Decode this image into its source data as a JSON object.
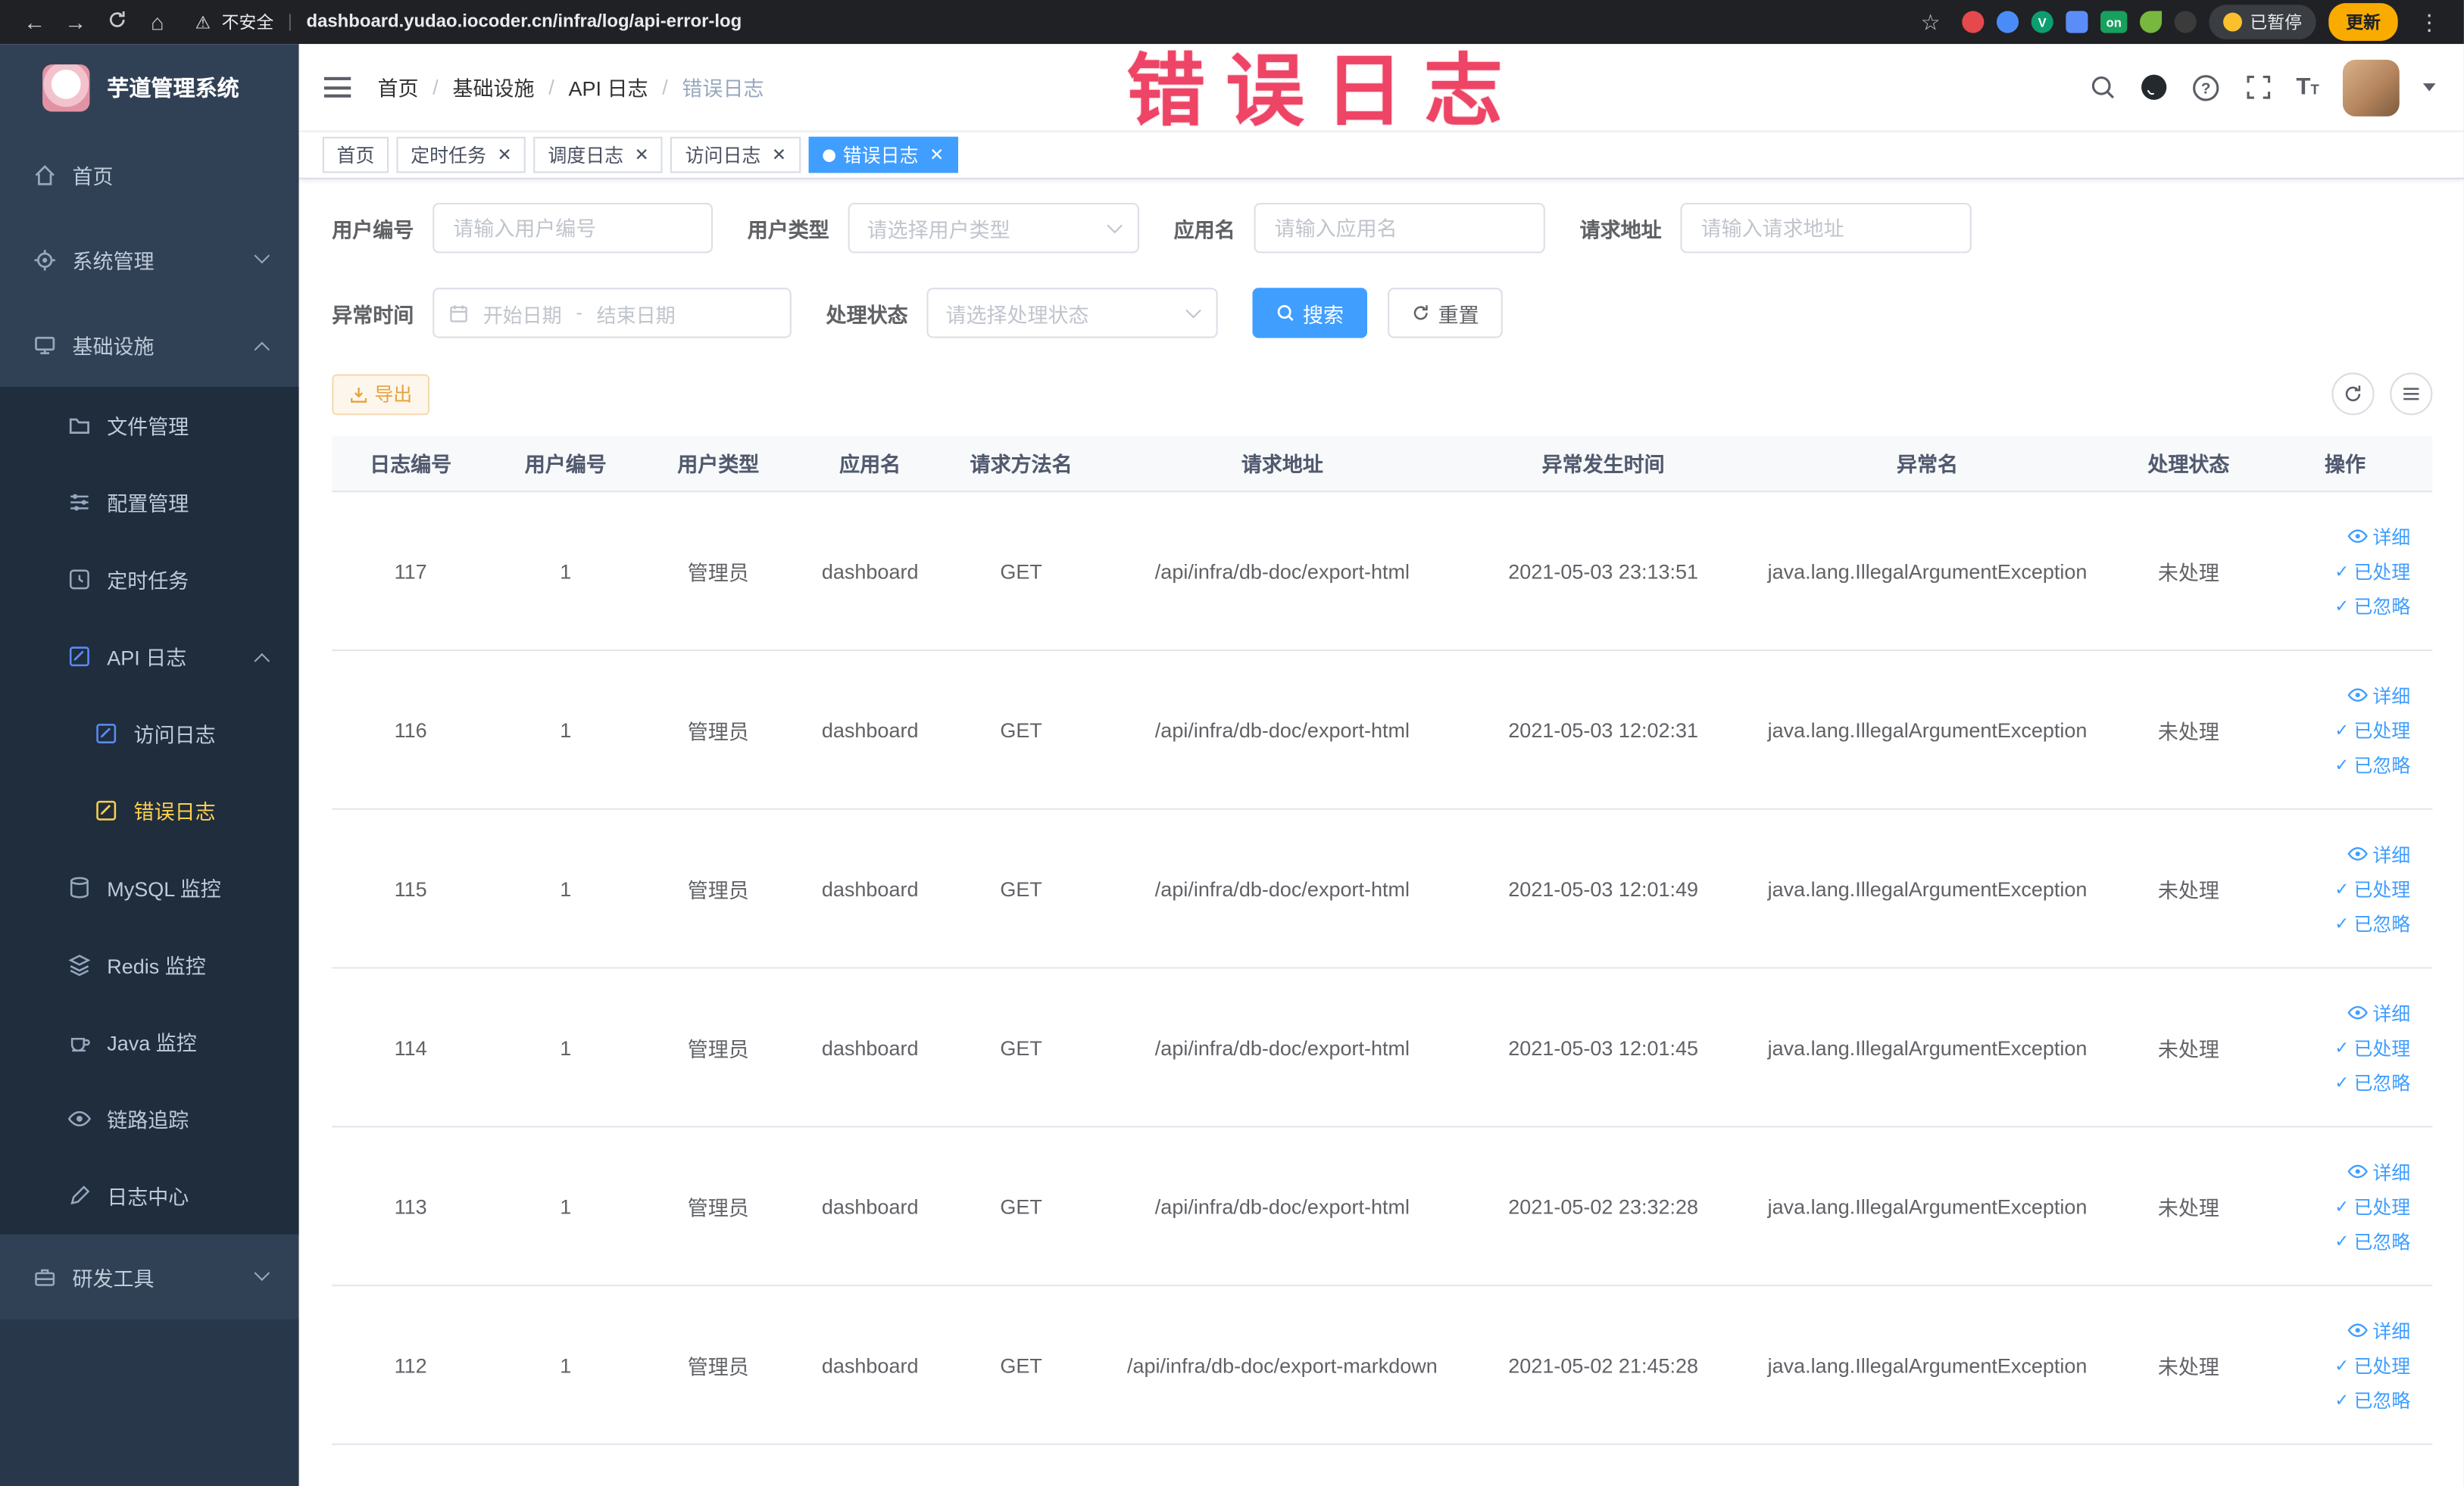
{
  "browser": {
    "security_label": "不安全",
    "url": "dashboard.yudao.iocoder.cn/infra/log/api-error-log",
    "extension_badge": "on",
    "paused_badge": "已暂停",
    "update_button": "更新"
  },
  "annotation": {
    "text": "错误日志",
    "color": "#ee4466"
  },
  "sidebar": {
    "logo_title": "芋道管理系统",
    "items": [
      {
        "label": "首页"
      },
      {
        "label": "系统管理"
      },
      {
        "label": "基础设施"
      },
      {
        "label": "文件管理"
      },
      {
        "label": "配置管理"
      },
      {
        "label": "定时任务"
      },
      {
        "label": "API 日志"
      },
      {
        "label": "访问日志"
      },
      {
        "label": "错误日志"
      },
      {
        "label": "MySQL 监控"
      },
      {
        "label": "Redis 监控"
      },
      {
        "label": "Java 监控"
      },
      {
        "label": "链路追踪"
      },
      {
        "label": "日志中心"
      },
      {
        "label": "研发工具"
      }
    ]
  },
  "breadcrumb": [
    "首页",
    "基础设施",
    "API 日志",
    "错误日志"
  ],
  "tabs": [
    {
      "label": "首页"
    },
    {
      "label": "定时任务"
    },
    {
      "label": "调度日志"
    },
    {
      "label": "访问日志"
    },
    {
      "label": "错误日志"
    }
  ],
  "filters": {
    "user_id": {
      "label": "用户编号",
      "placeholder": "请输入用户编号"
    },
    "user_type": {
      "label": "用户类型",
      "placeholder": "请选择用户类型"
    },
    "app_name": {
      "label": "应用名",
      "placeholder": "请输入应用名"
    },
    "request_url": {
      "label": "请求地址",
      "placeholder": "请输入请求地址"
    },
    "exception_time": {
      "label": "异常时间",
      "start_placeholder": "开始日期",
      "separator": "-",
      "end_placeholder": "结束日期"
    },
    "process_status": {
      "label": "处理状态",
      "placeholder": "请选择处理状态"
    },
    "search_button": "搜索",
    "reset_button": "重置"
  },
  "toolbar": {
    "export_button": "导出"
  },
  "table": {
    "columns": [
      "日志编号",
      "用户编号",
      "用户类型",
      "应用名",
      "请求方法名",
      "请求地址",
      "异常发生时间",
      "异常名",
      "处理状态",
      "操作"
    ],
    "actions": {
      "detail": "详细",
      "processed": "已处理",
      "ignored": "已忽略"
    },
    "rows": [
      {
        "id": "117",
        "user_id": "1",
        "user_type": "管理员",
        "app": "dashboard",
        "method": "GET",
        "url": "/api/infra/db-doc/export-html",
        "time": "2021-05-03 23:13:51",
        "exception": "java.lang.IllegalArgumentException",
        "status": "未处理"
      },
      {
        "id": "116",
        "user_id": "1",
        "user_type": "管理员",
        "app": "dashboard",
        "method": "GET",
        "url": "/api/infra/db-doc/export-html",
        "time": "2021-05-03 12:02:31",
        "exception": "java.lang.IllegalArgumentException",
        "status": "未处理"
      },
      {
        "id": "115",
        "user_id": "1",
        "user_type": "管理员",
        "app": "dashboard",
        "method": "GET",
        "url": "/api/infra/db-doc/export-html",
        "time": "2021-05-03 12:01:49",
        "exception": "java.lang.IllegalArgumentException",
        "status": "未处理"
      },
      {
        "id": "114",
        "user_id": "1",
        "user_type": "管理员",
        "app": "dashboard",
        "method": "GET",
        "url": "/api/infra/db-doc/export-html",
        "time": "2021-05-03 12:01:45",
        "exception": "java.lang.IllegalArgumentException",
        "status": "未处理"
      },
      {
        "id": "113",
        "user_id": "1",
        "user_type": "管理员",
        "app": "dashboard",
        "method": "GET",
        "url": "/api/infra/db-doc/export-html",
        "time": "2021-05-02 23:32:28",
        "exception": "java.lang.IllegalArgumentException",
        "status": "未处理"
      },
      {
        "id": "112",
        "user_id": "1",
        "user_type": "管理员",
        "app": "dashboard",
        "method": "GET",
        "url": "/api/infra/db-doc/export-markdown",
        "time": "2021-05-02 21:45:28",
        "exception": "java.lang.IllegalArgumentException",
        "status": "未处理"
      }
    ]
  }
}
